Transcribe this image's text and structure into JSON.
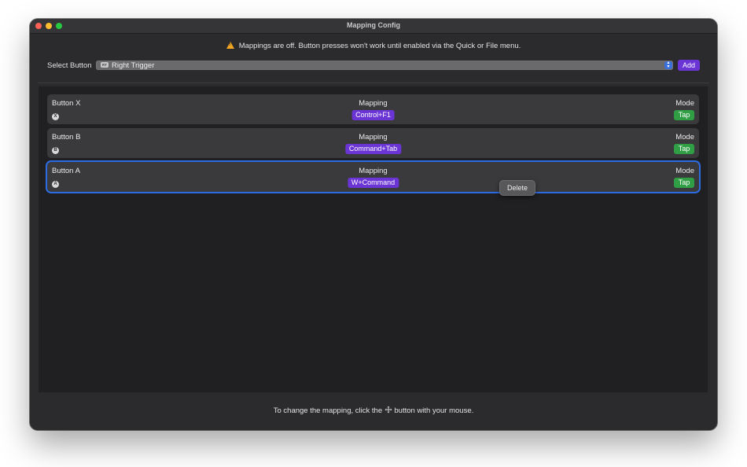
{
  "window": {
    "title": "Mapping Config"
  },
  "warning": {
    "icon": "warning-triangle-icon",
    "text": "Mappings are off. Button presses won't work until enabled via the Quick or File menu."
  },
  "select": {
    "label": "Select Button",
    "badge": "RT",
    "value": "Right Trigger"
  },
  "add_label": "Add",
  "columns": {
    "mapping": "Mapping",
    "mode": "Mode"
  },
  "rows": [
    {
      "name": "Button X",
      "glyph": "X",
      "mapping": "Control+F1",
      "mode": "Tap",
      "selected": false
    },
    {
      "name": "Button B",
      "glyph": "B",
      "mapping": "Command+Tab",
      "mode": "Tap",
      "selected": false
    },
    {
      "name": "Button A",
      "glyph": "A",
      "mapping": "W+Command",
      "mode": "Tap",
      "selected": true
    }
  ],
  "context_menu": {
    "delete_label": "Delete"
  },
  "footer": {
    "text_before": "To change the mapping, click the",
    "icon": "move-arrows-icon",
    "text_after": "button with your mouse."
  },
  "colors": {
    "accent_purple": "#6b35d6",
    "tap_green": "#2f9e44",
    "selection_blue": "#2d6be3",
    "warning_orange": "#f5a623"
  }
}
